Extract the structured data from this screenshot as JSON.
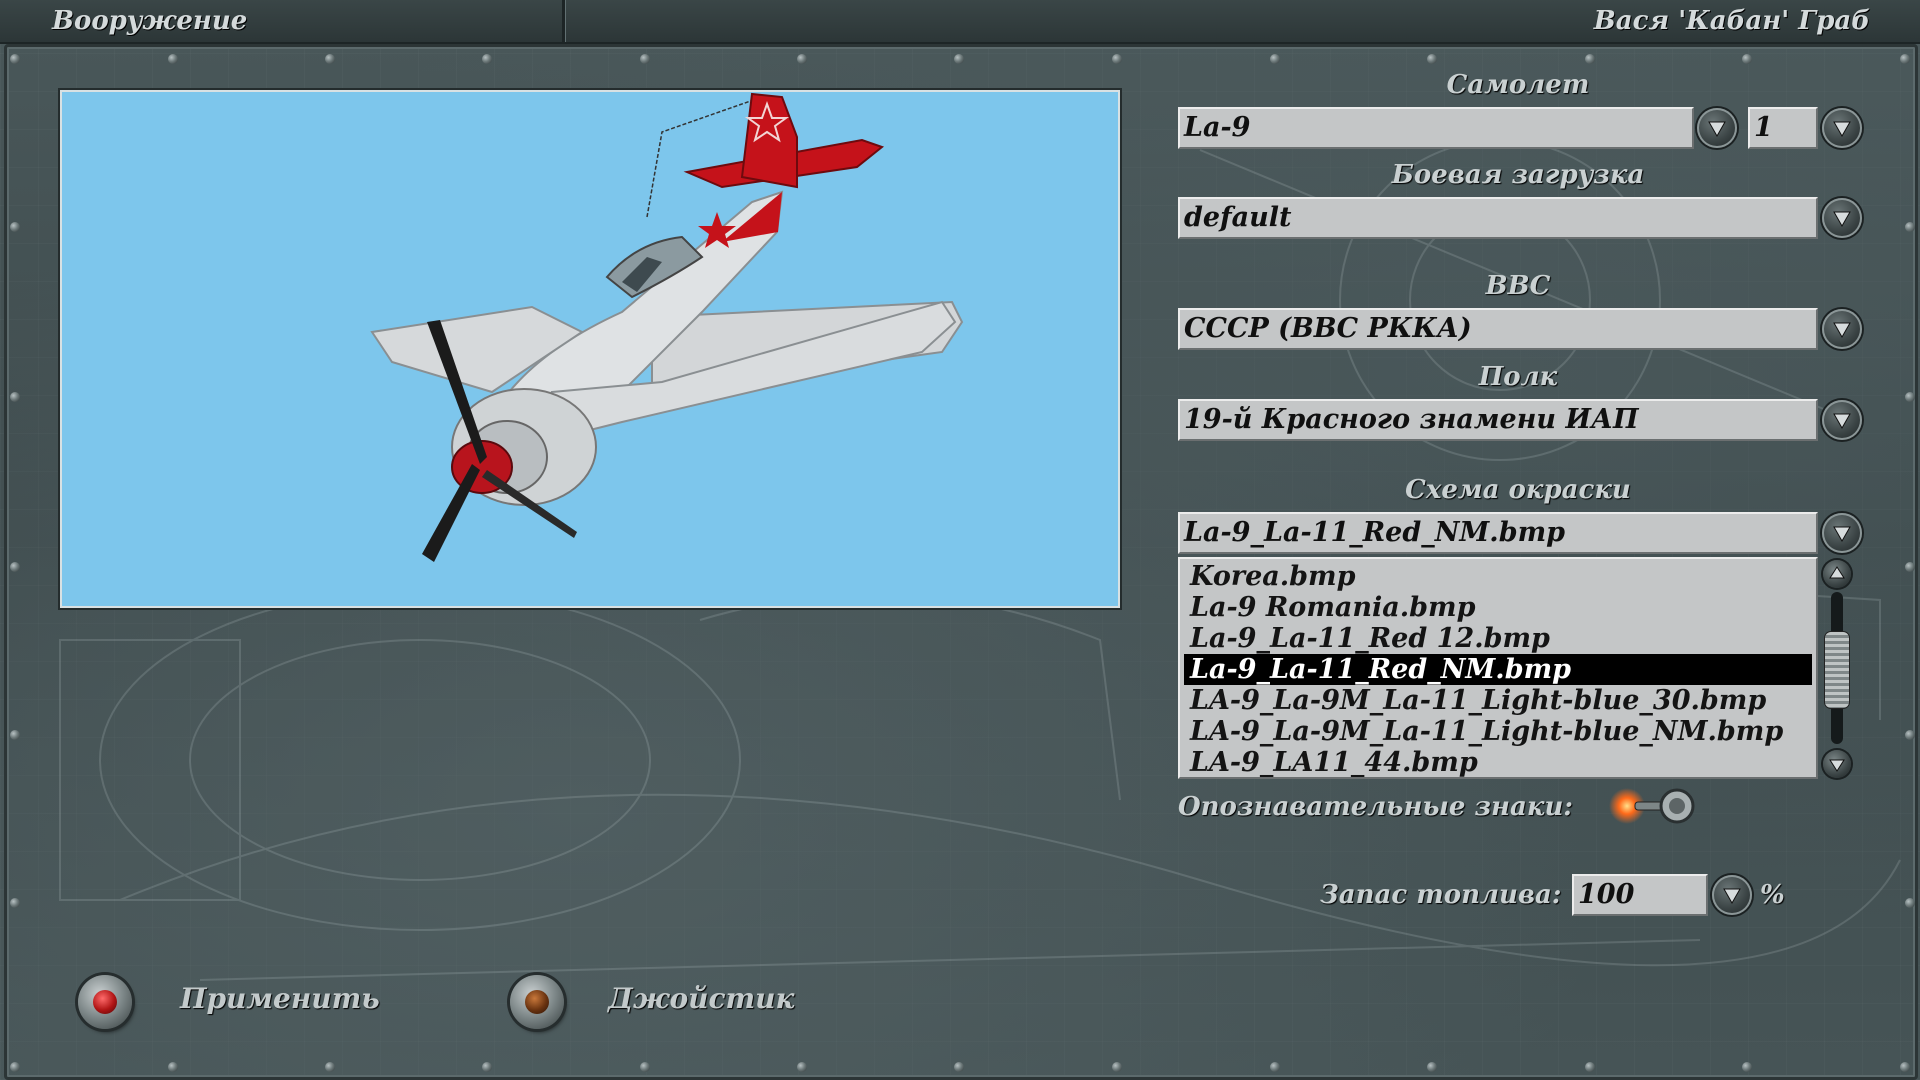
{
  "header": {
    "section_title": "Вооружение",
    "pilot_name": "Вася 'Кабан' Граб"
  },
  "aircraft": {
    "label": "Самолет",
    "value": "La-9",
    "count": "1"
  },
  "loadout": {
    "label": "Боевая загрузка",
    "value": "default"
  },
  "air_force": {
    "label": "ВВС",
    "value": "СССР (ВВС РККА)"
  },
  "regiment": {
    "label": "Полк",
    "value": "19-й Красного знамени ИАП"
  },
  "skin": {
    "label": "Схема окраски",
    "value": "La-9_La-11_Red_NM.bmp",
    "items": [
      "Korea.bmp",
      "La-9 Romania.bmp",
      "La-9_La-11_Red 12.bmp",
      "La-9_La-11_Red_NM.bmp",
      "LA-9_La-9M_La-11_Light-blue_30.bmp",
      "LA-9_La-9M_La-11_Light-blue_NM.bmp",
      "LA-9_LA11_44.bmp"
    ],
    "selected_index": 3
  },
  "markings": {
    "label": "Опознавательные знаки:",
    "enabled": true
  },
  "fuel": {
    "label": "Запас топлива:",
    "value": "100",
    "unit": "%"
  },
  "buttons": {
    "apply": "Применить",
    "joystick": "Джойстик"
  },
  "colors": {
    "preview_sky": "#7dc6ec",
    "selection": "#000000",
    "field_bg": "#c4c6c7",
    "apply_cap": "#b01515",
    "joystick_cap": "#6a3310",
    "indicator_on": "#ff6a1a"
  },
  "icons": {
    "dropdown": "chevron-down-icon",
    "scroll_up": "arrow-up-icon",
    "scroll_down": "arrow-down-icon"
  }
}
